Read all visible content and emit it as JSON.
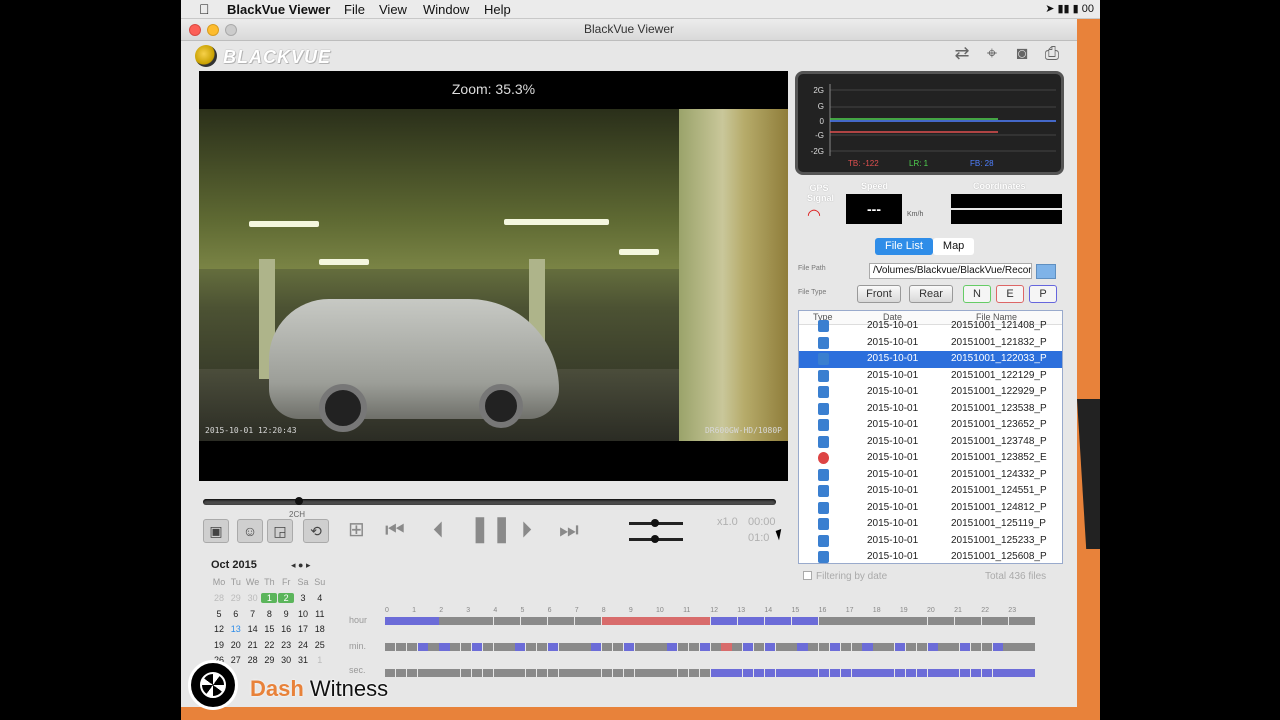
{
  "menubar": {
    "app_name": "BlackVue Viewer",
    "menus": [
      "File",
      "View",
      "Window",
      "Help"
    ],
    "clock": "00"
  },
  "window": {
    "title": "BlackVue Viewer",
    "logo_text": "BLACKVUE"
  },
  "toolbar_icons": [
    "repeat-icon",
    "crosshair-icon",
    "camera-icon",
    "print-icon"
  ],
  "video": {
    "zoom_label": "Zoom: 35.3%",
    "overlay_timestamp": "2015-10-01 12:20:43",
    "overlay_model": "DR600GW-HD/1080P"
  },
  "playback": {
    "channel_label": "2CH",
    "speed": "x1.0",
    "time_current": "00:00",
    "time_total": "01:0",
    "seek_fraction": 0.16,
    "volume_fraction": 0.45,
    "speed_fraction": 0.45
  },
  "gsensor": {
    "y_labels": [
      "2G",
      "G",
      "0",
      "-G",
      "-2G"
    ],
    "tb_label": "TB: -122",
    "lr_label": "LR: 1",
    "fb_label": "FB: 28",
    "colors": {
      "tb": "#e05050",
      "lr": "#50d050",
      "fb": "#5080ff"
    }
  },
  "gps": {
    "signal_label": "GPS Signal",
    "speed_label": "Speed",
    "speed_value": "---",
    "speed_unit": "Km/h",
    "coordinates_label": "Coordinates"
  },
  "tabs": {
    "file_list": "File List",
    "map": "Map"
  },
  "file_filter": {
    "path_label": "File Path",
    "path_value": "/Volumes/Blackvue/BlackVue/Record",
    "type_label": "File Type",
    "front": "Front",
    "rear": "Rear",
    "n": "N",
    "e": "E",
    "p": "P"
  },
  "file_list": {
    "headers": {
      "type": "Type",
      "date": "Date",
      "name": "File Name"
    },
    "rows": [
      {
        "date": "2015-10-01",
        "name": "20151001_121408_P",
        "type": "normal"
      },
      {
        "date": "2015-10-01",
        "name": "20151001_121832_P",
        "type": "normal"
      },
      {
        "date": "2015-10-01",
        "name": "20151001_122033_P",
        "type": "normal",
        "selected": true
      },
      {
        "date": "2015-10-01",
        "name": "20151001_122129_P",
        "type": "normal"
      },
      {
        "date": "2015-10-01",
        "name": "20151001_122929_P",
        "type": "normal"
      },
      {
        "date": "2015-10-01",
        "name": "20151001_123538_P",
        "type": "normal"
      },
      {
        "date": "2015-10-01",
        "name": "20151001_123652_P",
        "type": "normal"
      },
      {
        "date": "2015-10-01",
        "name": "20151001_123748_P",
        "type": "normal"
      },
      {
        "date": "2015-10-01",
        "name": "20151001_123852_E",
        "type": "event"
      },
      {
        "date": "2015-10-01",
        "name": "20151001_124332_P",
        "type": "normal"
      },
      {
        "date": "2015-10-01",
        "name": "20151001_124551_P",
        "type": "normal"
      },
      {
        "date": "2015-10-01",
        "name": "20151001_124812_P",
        "type": "normal"
      },
      {
        "date": "2015-10-01",
        "name": "20151001_125119_P",
        "type": "normal"
      },
      {
        "date": "2015-10-01",
        "name": "20151001_125233_P",
        "type": "normal"
      },
      {
        "date": "2015-10-01",
        "name": "20151001_125608_P",
        "type": "normal"
      }
    ],
    "filter_label": "Filtering by date",
    "total_label": "Total 436 files"
  },
  "calendar": {
    "month": "Oct 2015",
    "weekdays": [
      "Mo",
      "Tu",
      "We",
      "Th",
      "Fr",
      "Sa",
      "Su"
    ],
    "weeks": [
      [
        "28",
        "29",
        "30",
        "1",
        "2",
        "3",
        "4"
      ],
      [
        "5",
        "6",
        "7",
        "8",
        "9",
        "10",
        "11"
      ],
      [
        "12",
        "13",
        "14",
        "15",
        "16",
        "17",
        "18"
      ],
      [
        "19",
        "20",
        "21",
        "22",
        "23",
        "24",
        "25"
      ],
      [
        "26",
        "27",
        "28",
        "29",
        "30",
        "31",
        "1"
      ]
    ],
    "highlighted": [
      "1",
      "2"
    ],
    "today": "13"
  },
  "timeline": {
    "hour_label": "hour",
    "min_label": "min.",
    "sec_label": "sec.",
    "hour_ticks": [
      "0",
      "1",
      "2",
      "3",
      "4",
      "5",
      "6",
      "7",
      "8",
      "9",
      "10",
      "11",
      "12",
      "13",
      "14",
      "15",
      "16",
      "17",
      "18",
      "19",
      "20",
      "21",
      "22",
      "23"
    ],
    "colors": {
      "normal": "#6c6cd8",
      "event": "#d86c6c",
      "empty": "#8a8a8a"
    }
  },
  "watermark": {
    "brand1": "Dash",
    "brand2": "Witness"
  }
}
